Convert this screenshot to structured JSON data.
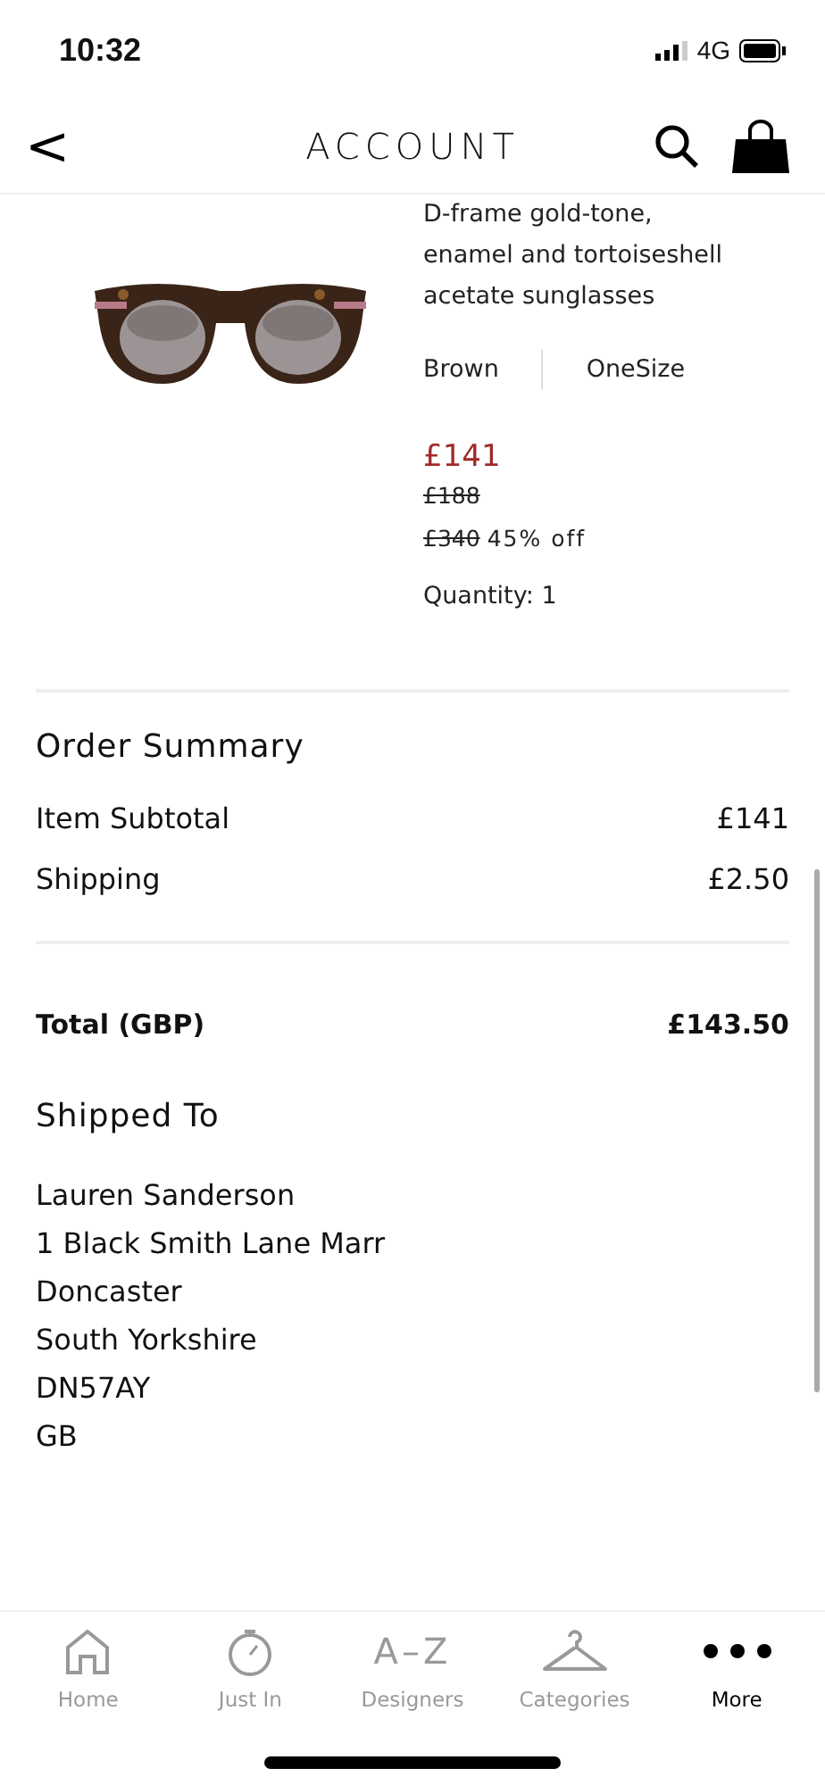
{
  "status_bar": {
    "time": "10:32",
    "network": "4G"
  },
  "header": {
    "back": "<",
    "title": "ACCOUNT"
  },
  "product": {
    "name": "D-frame gold-tone, enamel and tortoiseshell acetate sunglasses",
    "colour_name": "Brown",
    "size": "OneSize",
    "price": "£141",
    "previous_price": "£188",
    "original_price": "£340",
    "discount": "45% off",
    "quantity": "Quantity: 1"
  },
  "order_summary": {
    "title": "Order Summary",
    "rows": [
      {
        "label": "Item Subtotal",
        "value": "£141"
      },
      {
        "label": "Shipping",
        "value": "£2.50"
      }
    ],
    "total": {
      "label": "Total (GBP)",
      "value": "£143.50"
    }
  },
  "shipped_to": {
    "title": "Shipped To",
    "lines": [
      "Lauren Sanderson",
      "1 Black Smith Lane Marr",
      "Doncaster",
      "South Yorkshire",
      "DN57AY",
      "GB"
    ]
  },
  "tab_bar": [
    {
      "kind": "home",
      "label": "Home",
      "selected": false
    },
    {
      "kind": "timer",
      "label": "Just In",
      "selected": false
    },
    {
      "kind": "az",
      "glyph": "A–Z",
      "label": "Designers",
      "selected": false
    },
    {
      "kind": "hanger",
      "label": "Categories",
      "selected": false
    },
    {
      "kind": "dots",
      "label": "More",
      "selected": true
    }
  ]
}
